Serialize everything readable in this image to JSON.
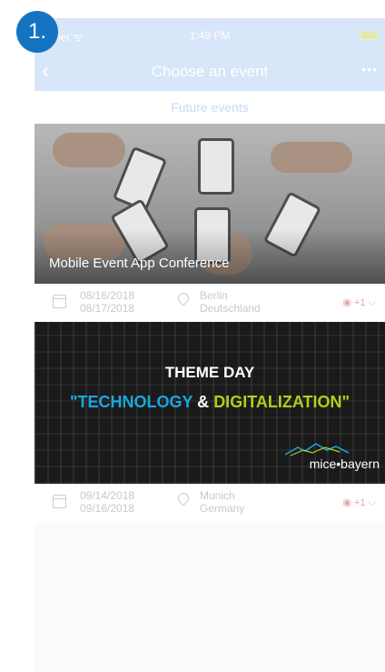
{
  "step_badge": "1.",
  "statusbar": {
    "carrier": "rier ᯤ",
    "time": "1:49 PM"
  },
  "navbar": {
    "back_icon": "‹",
    "title": "Choose an event",
    "more_icon": "•••"
  },
  "subheader": {
    "tab": "Future events"
  },
  "events": [
    {
      "name": "Mobile Event App Conference",
      "date_start": "08/16/2018",
      "date_end": "08/17/2018",
      "city": "Berlin",
      "country": "Deutschland",
      "language": "+1 ⌵"
    },
    {
      "banner_line1": "THEME DAY",
      "banner_quote_open": "\"",
      "banner_word1": "TECHNOLOGY",
      "banner_amp": " & ",
      "banner_word2": "DIGITALIZATION",
      "banner_quote_close": "\"",
      "banner_logo": "mice•bayern",
      "date_start": "09/14/2018",
      "date_end": "09/16/2018",
      "city": "Munich",
      "country": "Germany",
      "language": "+1 ⌵"
    }
  ]
}
